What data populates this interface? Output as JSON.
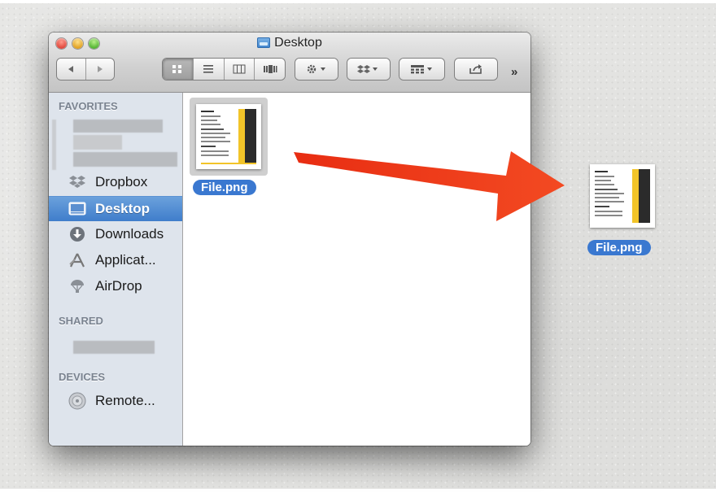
{
  "window": {
    "title": "Desktop",
    "toolbar": {
      "back_icon": "back-arrow-icon",
      "forward_icon": "forward-arrow-icon",
      "view_modes": [
        "icon-view-icon",
        "list-view-icon",
        "column-view-icon",
        "coverflow-view-icon"
      ],
      "active_view": "icon-view-icon",
      "action_icon": "gear-icon",
      "dropbox_icon": "dropbox-icon",
      "arrange_icon": "arrange-grid-icon",
      "share_icon": "share-icon",
      "overflow": "»"
    }
  },
  "sidebar": {
    "favorites_header": "FAVORITES",
    "favorites": [
      {
        "label": "Dropbox",
        "icon": "dropbox-icon"
      },
      {
        "label": "Desktop",
        "icon": "desktop-icon",
        "selected": true
      },
      {
        "label": "Downloads",
        "icon": "downloads-icon"
      },
      {
        "label": "Applicat...",
        "icon": "applications-icon"
      },
      {
        "label": "AirDrop",
        "icon": "airdrop-icon"
      }
    ],
    "shared_header": "SHARED",
    "devices_header": "DEVICES",
    "devices": [
      {
        "label": "Remote...",
        "icon": "remote-disc-icon"
      }
    ]
  },
  "window_file": {
    "name": "File.png"
  },
  "desktop_file": {
    "name": "File.png"
  },
  "colors": {
    "selection_blue": "#3a78d0",
    "sidebar_bg": "#dee4ec",
    "arrow_red": "#f03a17",
    "thumb_yellow": "#f2c429"
  }
}
